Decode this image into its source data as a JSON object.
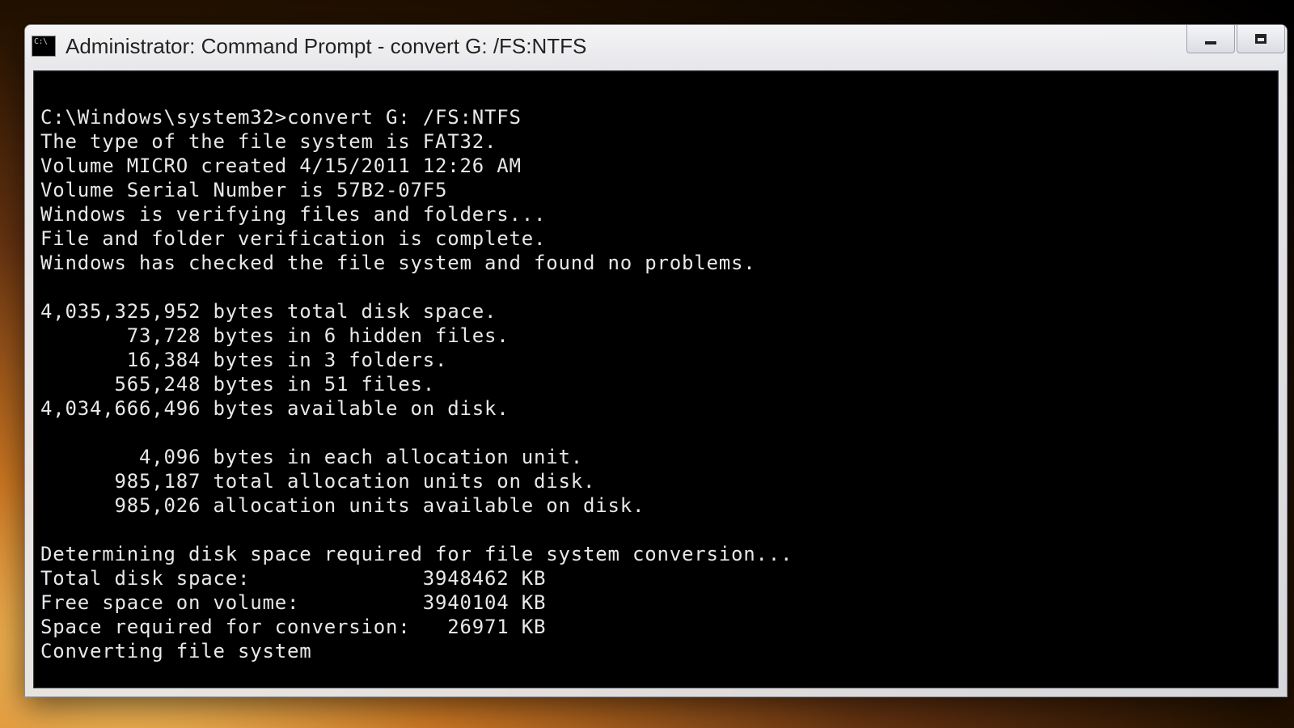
{
  "window": {
    "title": "Administrator: Command Prompt - convert  G: /FS:NTFS"
  },
  "console": {
    "prompt_path": "C:\\Windows\\system32>",
    "command": "convert G: /FS:NTFS",
    "lines": [
      "The type of the file system is FAT32.",
      "Volume MICRO created 4/15/2011 12:26 AM",
      "Volume Serial Number is 57B2-07F5",
      "Windows is verifying files and folders...",
      "File and folder verification is complete.",
      "Windows has checked the file system and found no problems.",
      "",
      "4,035,325,952 bytes total disk space.",
      "       73,728 bytes in 6 hidden files.",
      "       16,384 bytes in 3 folders.",
      "      565,248 bytes in 51 files.",
      "4,034,666,496 bytes available on disk.",
      "",
      "        4,096 bytes in each allocation unit.",
      "      985,187 total allocation units on disk.",
      "      985,026 allocation units available on disk.",
      "",
      "Determining disk space required for file system conversion...",
      "Total disk space:              3948462 KB",
      "Free space on volume:          3940104 KB",
      "Space required for conversion:   26971 KB",
      "Converting file system"
    ]
  }
}
